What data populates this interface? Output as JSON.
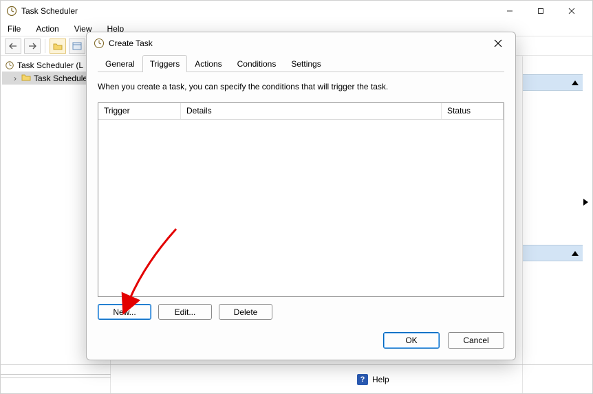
{
  "app": {
    "title": "Task Scheduler"
  },
  "menubar": {
    "file": "File",
    "action": "Action",
    "view": "View",
    "help": "Help"
  },
  "tree": {
    "root": "Task Scheduler (L",
    "library": "Task Schedule"
  },
  "bottom": {
    "help": "Help"
  },
  "dialog": {
    "title": "Create Task",
    "tabs": {
      "general": "General",
      "triggers": "Triggers",
      "actions": "Actions",
      "conditions": "Conditions",
      "settings": "Settings"
    },
    "description": "When you create a task, you can specify the conditions that will trigger the task.",
    "columns": {
      "trigger": "Trigger",
      "details": "Details",
      "status": "Status"
    },
    "buttons": {
      "new": "New...",
      "edit": "Edit...",
      "delete": "Delete",
      "ok": "OK",
      "cancel": "Cancel"
    }
  }
}
